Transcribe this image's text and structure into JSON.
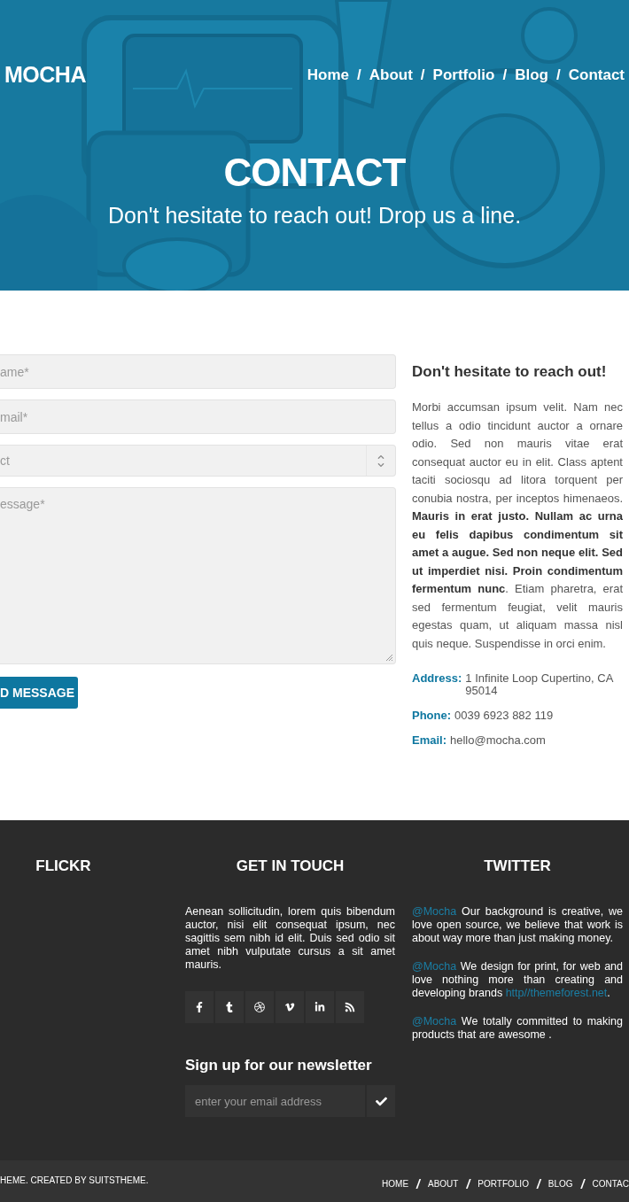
{
  "header": {
    "logo": "MOCHA",
    "nav": [
      {
        "label": "Home"
      },
      {
        "label": "About"
      },
      {
        "label": "Portfolio"
      },
      {
        "label": "Blog"
      },
      {
        "label": "Contact"
      }
    ],
    "separator": "/"
  },
  "hero": {
    "kind": "picture",
    "title": "CONTACT",
    "subtitle": "Don't hesitate to reach out! Drop us a line."
  },
  "form": {
    "fields": [
      {
        "kind": "input",
        "placeholder": "ame*"
      },
      {
        "kind": "input",
        "placeholder": "mail*"
      },
      {
        "kind": "select",
        "placeholder": "ct"
      },
      {
        "kind": "textarea",
        "placeholder": "essage*"
      }
    ],
    "submit": "D MESSAGE"
  },
  "info": {
    "heading": "Don't hesitate to reach out!",
    "body": "Morbi accumsan ipsum velit. Nam nec tellus a odio tincidunt auctor a ornare odio. Sed non mauris vitae erat consequat auctor eu in elit. Class aptent taciti sociosqu ad litora torquent per conubia nostra, per inceptos himenaeos. **Mauris in erat justo. Nullam ac urna eu felis dapibus condimentum sit amet a augue. Sed non neque elit. Sed ut imperdiet nisi. Proin condimentum fermentum nunc**. Etiam pharetra, erat sed fermentum feugiat, velit mauris egestas quam, ut aliquam massa nisl quis neque. Suspendisse in orci enim.",
    "contacts": [
      {
        "label": "Address:",
        "value": "1 Infinite Loop Cupertino, CA 95014"
      },
      {
        "label": "Phone:",
        "value": "0039 6923 882 119"
      },
      {
        "label": "Email:",
        "value": "hello@mocha.com"
      }
    ]
  },
  "footer": {
    "flickr": {
      "title": "FLICKR"
    },
    "touch": {
      "title": "GET IN TOUCH",
      "text": "Aenean sollicitudin, lorem quis bibendum auctor, nisi elit consequat ipsum, nec sagittis sem nibh id elit. Duis sed odio sit amet nibh vulputate cursus a sit amet mauris.",
      "newsletter_title": "Sign up for our newsletter",
      "newsletter_placeholder": "enter your email address"
    },
    "twitter": {
      "title": "TWITTER",
      "tweets": [
        {
          "handle": "@Mocha",
          "text": " Our background is creative, we love open source, we believe that work is about way more than just making money."
        },
        {
          "handle": "@Mocha",
          "text": " We design for print, for web and love nothing more than creating and developing brands ",
          "link": "http//themeforest.net",
          "tail": "."
        },
        {
          "handle": "@Mocha",
          "text": " We totally committed to making products that are awesome ."
        }
      ]
    }
  },
  "bottom": {
    "copyright": "HEME. CREATED BY SUITSTHEME.",
    "nav": [
      "HOME",
      "ABOUT",
      "PORTFOLIO",
      "BLOG",
      "CONTAC"
    ],
    "separator": "/"
  }
}
